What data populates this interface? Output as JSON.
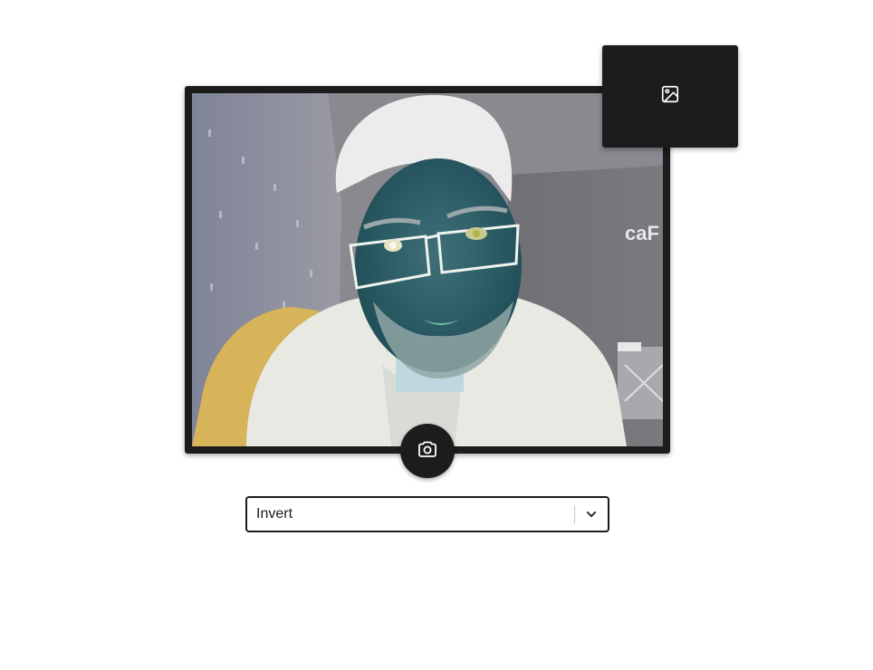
{
  "camera": {
    "feed_description_icon": "camera-feed",
    "frame_color": "#1c1c1c"
  },
  "capture": {
    "icon": "camera-icon"
  },
  "gallery": {
    "icon": "image-icon"
  },
  "filter": {
    "selected": "Invert",
    "arrow_icon": "chevron-down-icon"
  }
}
